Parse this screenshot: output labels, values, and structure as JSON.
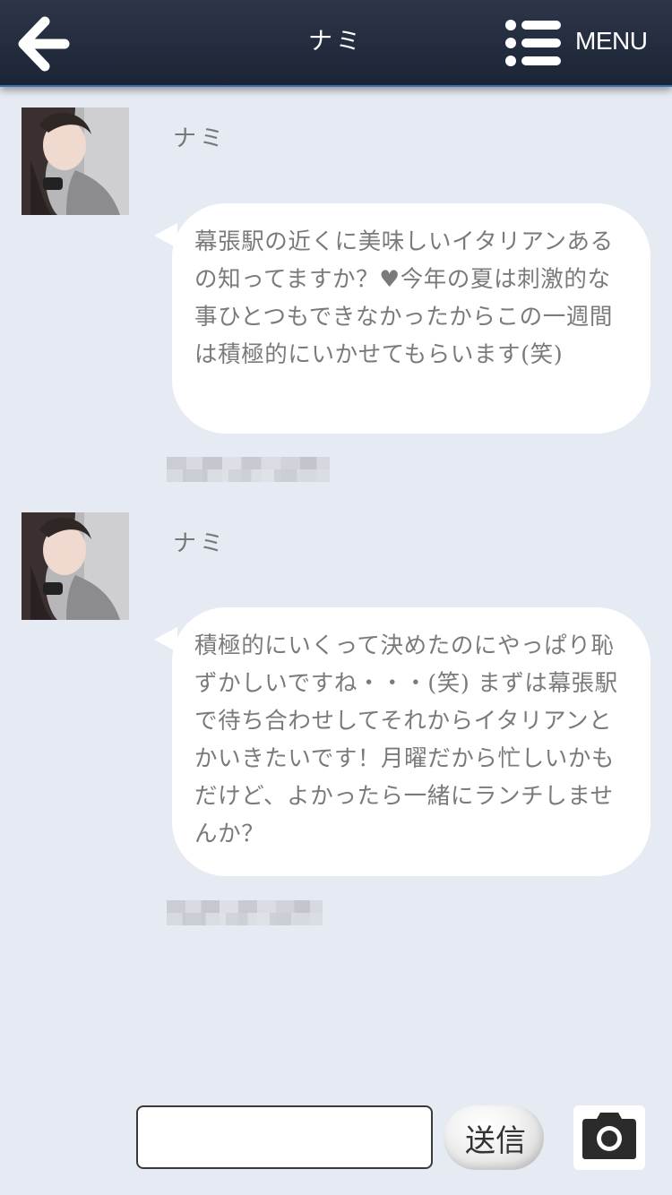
{
  "header": {
    "title": "ナミ",
    "menu_label": "MENU"
  },
  "messages": [
    {
      "sender": "ナミ",
      "text": "幕張駅の近くに美味しいイタリアンあるの知ってますか？♥今年の夏は刺激的な事ひとつもできなかったからこの一週間は積極的にいかせてもらいます(笑)"
    },
    {
      "sender": "ナミ",
      "text": "積極的にいくって決めたのにやっぱり恥ずかしいですね・・・(笑) まずは幕張駅で待ち合わせしてそれからイタリアンとかいきたいです！月曜だから忙しいかもだけど、よかったら一緒にランチしませんか？"
    }
  ],
  "composer": {
    "input_value": "",
    "send_label": "送信"
  },
  "colors": {
    "header_bg": "#1c2536",
    "page_bg": "#e6eaf2",
    "bubble_bg": "#ffffff",
    "bubble_text": "#7a7a7a"
  }
}
